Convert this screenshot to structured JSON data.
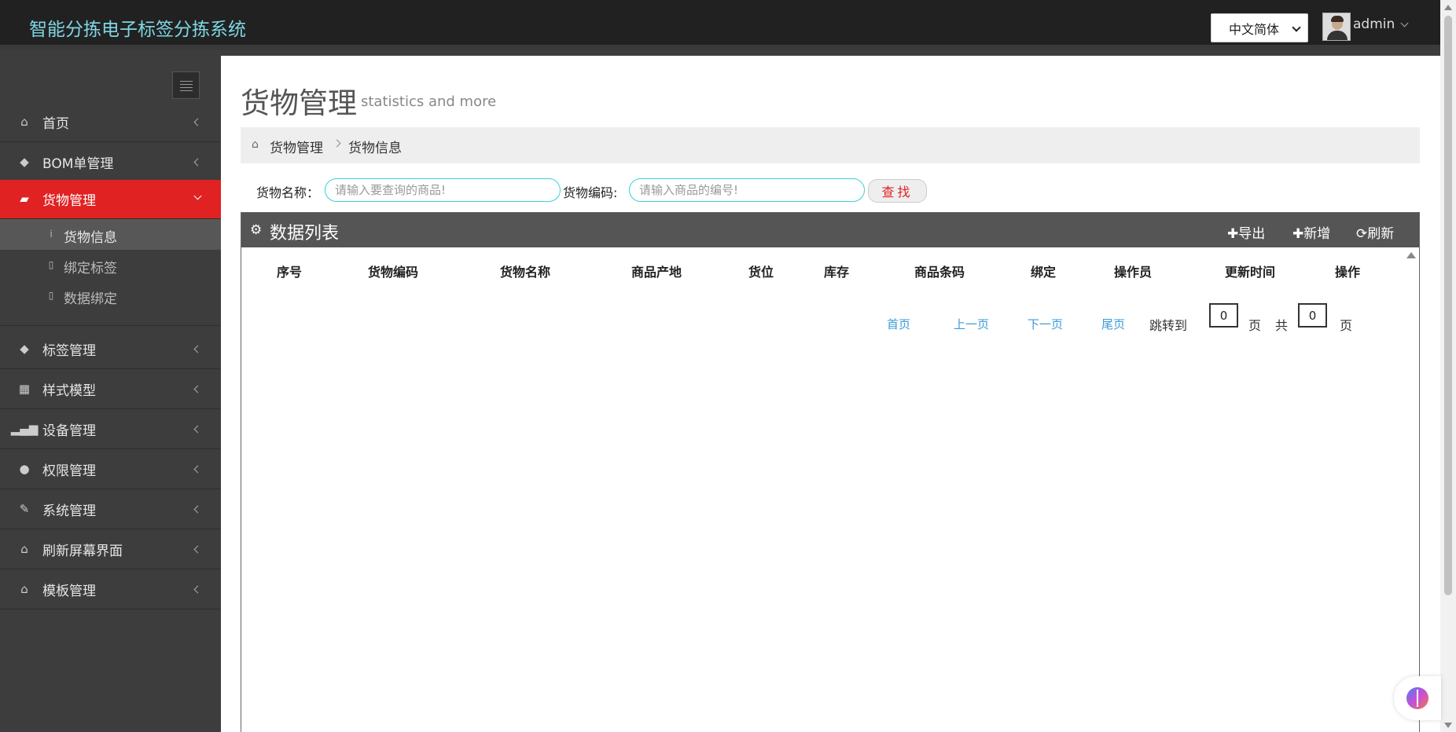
{
  "header": {
    "brand": "智能分拣电子标签分拣系统",
    "language": "中文简体",
    "user": "admin"
  },
  "sidebar": {
    "items": [
      {
        "label": "首页",
        "icon": "home-icon"
      },
      {
        "label": "BOM单管理",
        "icon": "tags-icon"
      },
      {
        "label": "货物管理",
        "icon": "folder-icon"
      },
      {
        "label": "标签管理",
        "icon": "tags-icon"
      },
      {
        "label": "样式模型",
        "icon": "grid-icon"
      },
      {
        "label": "设备管理",
        "icon": "signal-icon"
      },
      {
        "label": "权限管理",
        "icon": "user-icon"
      },
      {
        "label": "系统管理",
        "icon": "edit-icon"
      },
      {
        "label": "刷新屏幕界面",
        "icon": "home-icon"
      },
      {
        "label": "模板管理",
        "icon": "home-icon"
      }
    ],
    "sub_items": [
      {
        "label": "货物信息",
        "icon": "info-icon"
      },
      {
        "label": "绑定标签",
        "icon": "mobile-icon"
      },
      {
        "label": "数据绑定",
        "icon": "mobile-icon"
      }
    ],
    "active_color": "#e02222"
  },
  "page": {
    "title": "货物管理",
    "subtitle": "statistics and more",
    "breadcrumb": [
      "货物管理",
      "货物信息"
    ]
  },
  "search": {
    "name_label": "货物名称：",
    "name_placeholder": "请输入要查询的商品!",
    "code_label": "货物编码:",
    "code_placeholder": "请输入商品的编号!",
    "button": "查找"
  },
  "panel": {
    "title": "数据列表",
    "export": "导出",
    "add": "新增",
    "refresh": "刷新"
  },
  "table": {
    "columns": [
      "序号",
      "货物编码",
      "货物名称",
      "商品产地",
      "货位",
      "库存",
      "商品条码",
      "绑定",
      "操作员",
      "更新时间",
      "操作"
    ]
  },
  "pager": {
    "first": "首页",
    "prev": "上一页",
    "next": "下一页",
    "last": "尾页",
    "jump_label": "跳转到",
    "jump_value": "0",
    "page_unit": "页",
    "total_label": "共",
    "total_value": "0",
    "total_unit": "页"
  }
}
